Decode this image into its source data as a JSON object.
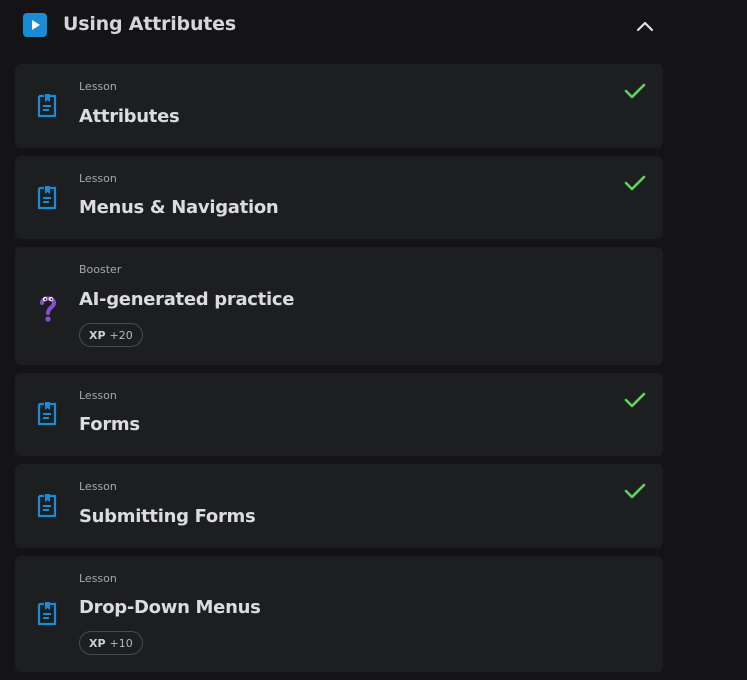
{
  "section": {
    "title": "Using Attributes",
    "icon": "play-icon",
    "collapse_icon": "chevron-up-icon"
  },
  "items": [
    {
      "type": "Lesson",
      "title": "Attributes",
      "icon": "document-icon",
      "completed": true
    },
    {
      "type": "Lesson",
      "title": "Menus & Navigation",
      "icon": "document-icon",
      "completed": true
    },
    {
      "type": "Booster",
      "title": "AI-generated practice",
      "icon": "question-mark-icon",
      "completed": false,
      "xp_label": "XP",
      "xp_value": "+20"
    },
    {
      "type": "Lesson",
      "title": "Forms",
      "icon": "document-icon",
      "completed": true
    },
    {
      "type": "Lesson",
      "title": "Submitting Forms",
      "icon": "document-icon",
      "completed": true
    },
    {
      "type": "Lesson",
      "title": "Drop-Down Menus",
      "icon": "document-icon",
      "completed": false,
      "xp_label": "XP",
      "xp_value": "+10"
    }
  ],
  "colors": {
    "accent_blue": "#1c8bd6",
    "check_green": "#5fd35a",
    "booster_purple": "#8a4fd6"
  }
}
